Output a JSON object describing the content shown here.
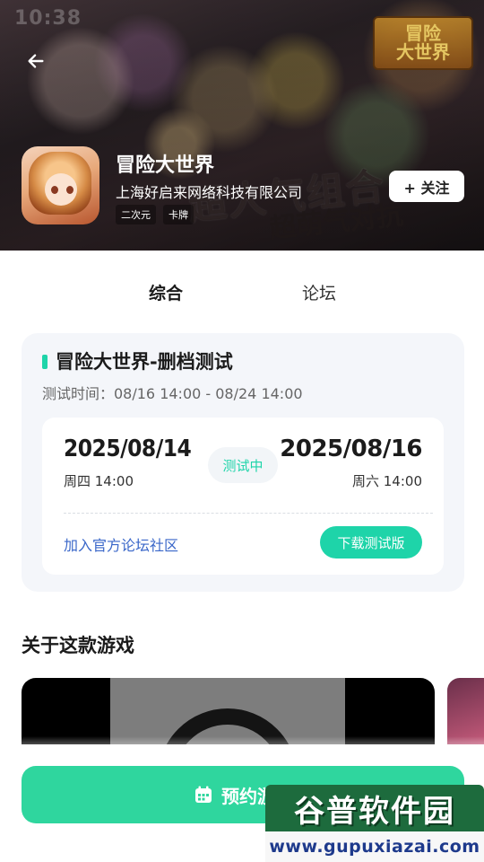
{
  "status_bar": {
    "time_ghost": "10:38"
  },
  "header": {
    "back_icon": "arrow-left-icon",
    "game_title": "冒险大世界",
    "developer": "上海好启来网络科技有限公司",
    "tags": [
      "二次元",
      "卡牌"
    ],
    "follow_label": "+ 关注",
    "banner_logo": "冒险\n大世界",
    "banner_slogan_1": "超人气组合",
    "banner_slogan_2": "超萌气对抗"
  },
  "tabs": [
    {
      "label": "综合",
      "active": true
    },
    {
      "label": "论坛",
      "active": false
    }
  ],
  "test_card": {
    "title": "冒险大世界-删档测试",
    "time_range": "测试时间：08/16 14:00 - 08/24 14:00",
    "start_date": "2025/08/14",
    "start_day": "周四 14:00",
    "end_date": "2025/08/16",
    "end_day": "周六 14:00",
    "status": "测试中",
    "forum_link": "加入官方论坛社区",
    "download_label": "下载测试版",
    "accent_color": "#1ed4a9"
  },
  "about": {
    "title": "关于这款游戏"
  },
  "cta": {
    "label": "预约游戏",
    "icon": "calendar-icon",
    "color": "#2fd69e"
  },
  "watermark": {
    "top": "谷普软件园",
    "bottom": "www.gupuxiazai.com"
  }
}
